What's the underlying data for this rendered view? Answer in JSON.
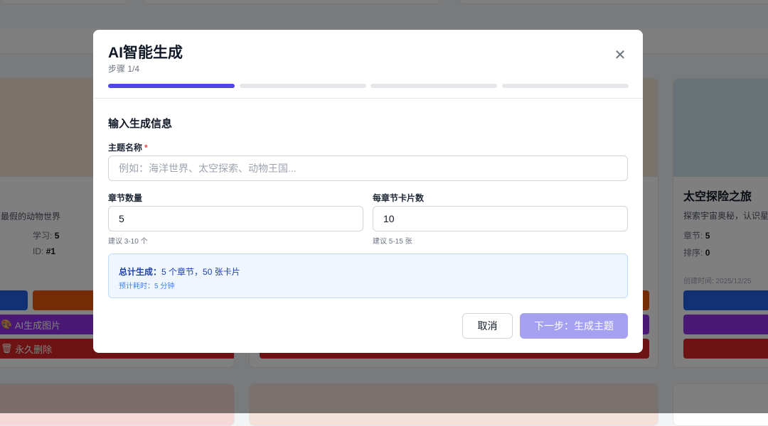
{
  "background": {
    "left_card": {
      "description": "最假的动物世界",
      "study_label": "学习:",
      "study_value": "5",
      "id_label": "ID:",
      "id_value": "#1",
      "ai_image_button": "AI生成图片",
      "delete_button": "永久删除"
    },
    "right_card": {
      "title": "太空探险之旅",
      "description": "探索宇宙奥秘，认识星",
      "chapters_label": "章节:",
      "chapters_value": "5",
      "order_label": "排序:",
      "order_value": "0",
      "created": "创建时间: 2025/12/25"
    }
  },
  "modal": {
    "title": "AI智能生成",
    "step": "步骤 1/4",
    "progress": {
      "current": 1,
      "total": 4
    },
    "section_title": "输入生成信息",
    "topic": {
      "label": "主题名称",
      "required": "*",
      "value": "",
      "placeholder": "例如：海洋世界、太空探索、动物王国..."
    },
    "chapters": {
      "label": "章节数量",
      "value": "5",
      "hint": "建议 3-10 个"
    },
    "cards_per_chapter": {
      "label": "每章节卡片数",
      "value": "10",
      "hint": "建议 5-15 张"
    },
    "summary": {
      "label": "总计生成：",
      "value": "5 个章节，50 张卡片",
      "eta": "预计耗时：5 分钟"
    },
    "cancel": "取消",
    "next": "下一步：生成主题"
  },
  "colors": {
    "accent": "#4f46e5",
    "next_disabled": "#a5a0f0"
  }
}
